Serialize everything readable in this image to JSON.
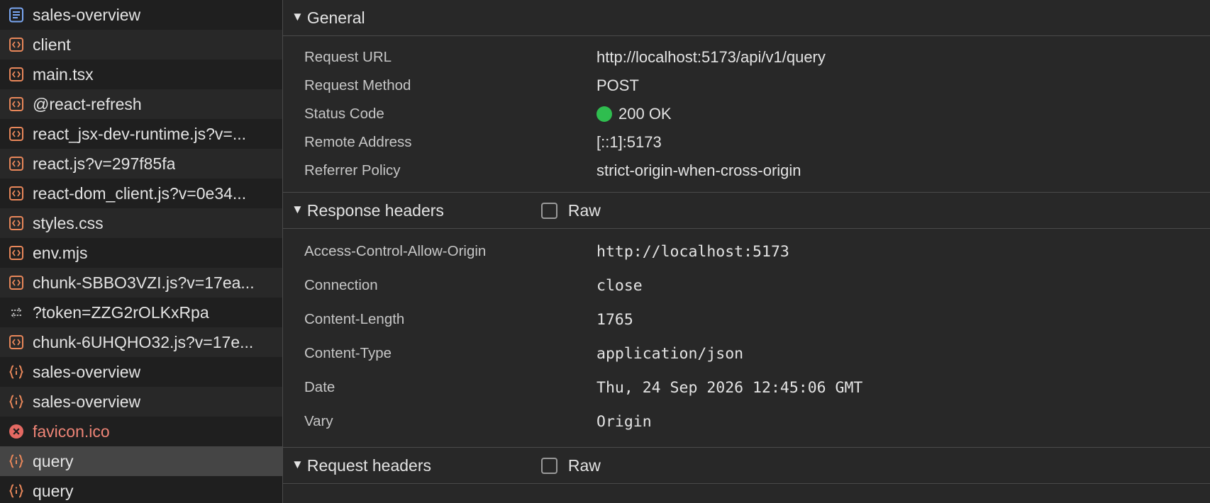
{
  "requests": [
    {
      "name": "sales-overview",
      "icon": "document-icon"
    },
    {
      "name": "client",
      "icon": "script-icon"
    },
    {
      "name": "main.tsx",
      "icon": "script-icon"
    },
    {
      "name": "@react-refresh",
      "icon": "script-icon"
    },
    {
      "name": "react_jsx-dev-runtime.js?v=...",
      "icon": "script-icon"
    },
    {
      "name": "react.js?v=297f85fa",
      "icon": "script-icon"
    },
    {
      "name": "react-dom_client.js?v=0e34...",
      "icon": "script-icon"
    },
    {
      "name": "styles.css",
      "icon": "script-icon"
    },
    {
      "name": "env.mjs",
      "icon": "script-icon"
    },
    {
      "name": "chunk-SBBO3VZI.js?v=17ea...",
      "icon": "script-icon"
    },
    {
      "name": "?token=ZZG2rOLKxRpa",
      "icon": "websocket-icon"
    },
    {
      "name": "chunk-6UHQHO32.js?v=17e...",
      "icon": "script-icon"
    },
    {
      "name": "sales-overview",
      "icon": "fetch-icon"
    },
    {
      "name": "sales-overview",
      "icon": "fetch-icon"
    },
    {
      "name": "favicon.ico",
      "icon": "error-icon"
    },
    {
      "name": "query",
      "icon": "fetch-icon"
    },
    {
      "name": "query",
      "icon": "fetch-icon"
    }
  ],
  "general": {
    "title": "General",
    "rows": [
      {
        "key": "Request URL",
        "value": "http://localhost:5173/api/v1/query"
      },
      {
        "key": "Request Method",
        "value": "POST"
      },
      {
        "key": "Status Code",
        "value": "200 OK"
      },
      {
        "key": "Remote Address",
        "value": "[::1]:5173"
      },
      {
        "key": "Referrer Policy",
        "value": "strict-origin-when-cross-origin"
      }
    ]
  },
  "response_headers": {
    "title": "Response headers",
    "raw_label": "Raw",
    "rows": [
      {
        "key": "Access-Control-Allow-Origin",
        "value": "http://localhost:5173"
      },
      {
        "key": "Connection",
        "value": "close"
      },
      {
        "key": "Content-Length",
        "value": "1765"
      },
      {
        "key": "Content-Type",
        "value": "application/json"
      },
      {
        "key": "Date",
        "value": "Thu, 24 Sep 2026 12:45:06 GMT"
      },
      {
        "key": "Vary",
        "value": "Origin"
      }
    ]
  },
  "request_headers": {
    "title": "Request headers",
    "raw_label": "Raw"
  },
  "colors": {
    "status_ok": "#2fbd4f",
    "error_text": "#ee8476",
    "script_icon": "#e8875a",
    "document_icon": "#7aa7f2"
  }
}
